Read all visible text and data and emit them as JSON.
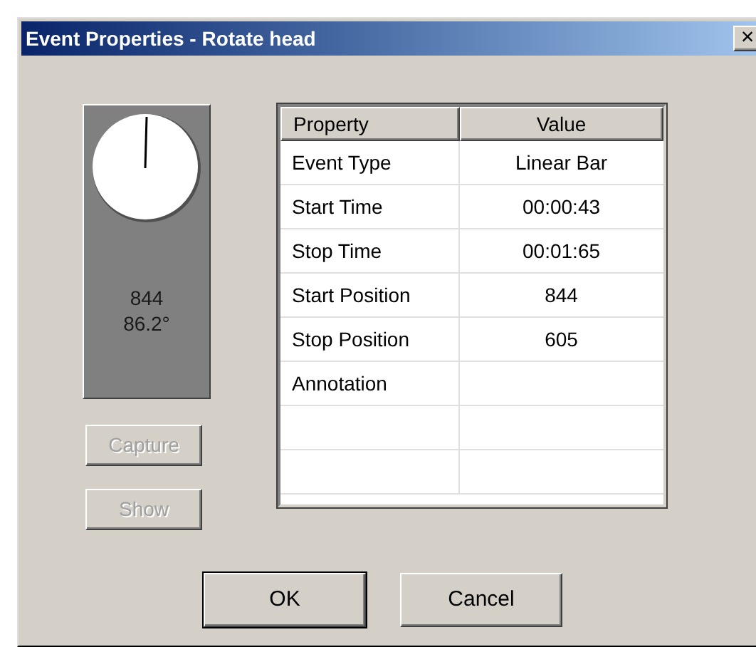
{
  "window": {
    "title": "Event Properties - Rotate head",
    "close": "×"
  },
  "dial": {
    "reading": "844",
    "angle": "86.2°"
  },
  "side_buttons": [
    {
      "label": "Capture",
      "disabled": true
    },
    {
      "label": "Show",
      "disabled": true
    }
  ],
  "table": {
    "columns": [
      "Property",
      "Value"
    ],
    "rows": [
      {
        "property": "Event Type",
        "value": "Linear Bar"
      },
      {
        "property": "Start Time",
        "value": "00:00:43"
      },
      {
        "property": "Stop Time",
        "value": "00:01:65"
      },
      {
        "property": "Start Position",
        "value": "844"
      },
      {
        "property": "Stop Position",
        "value": "605"
      },
      {
        "property": "Annotation"
      }
    ]
  },
  "buttons": [
    {
      "label": "OK",
      "default": true
    },
    {
      "label": "Cancel",
      "default": false
    }
  ]
}
